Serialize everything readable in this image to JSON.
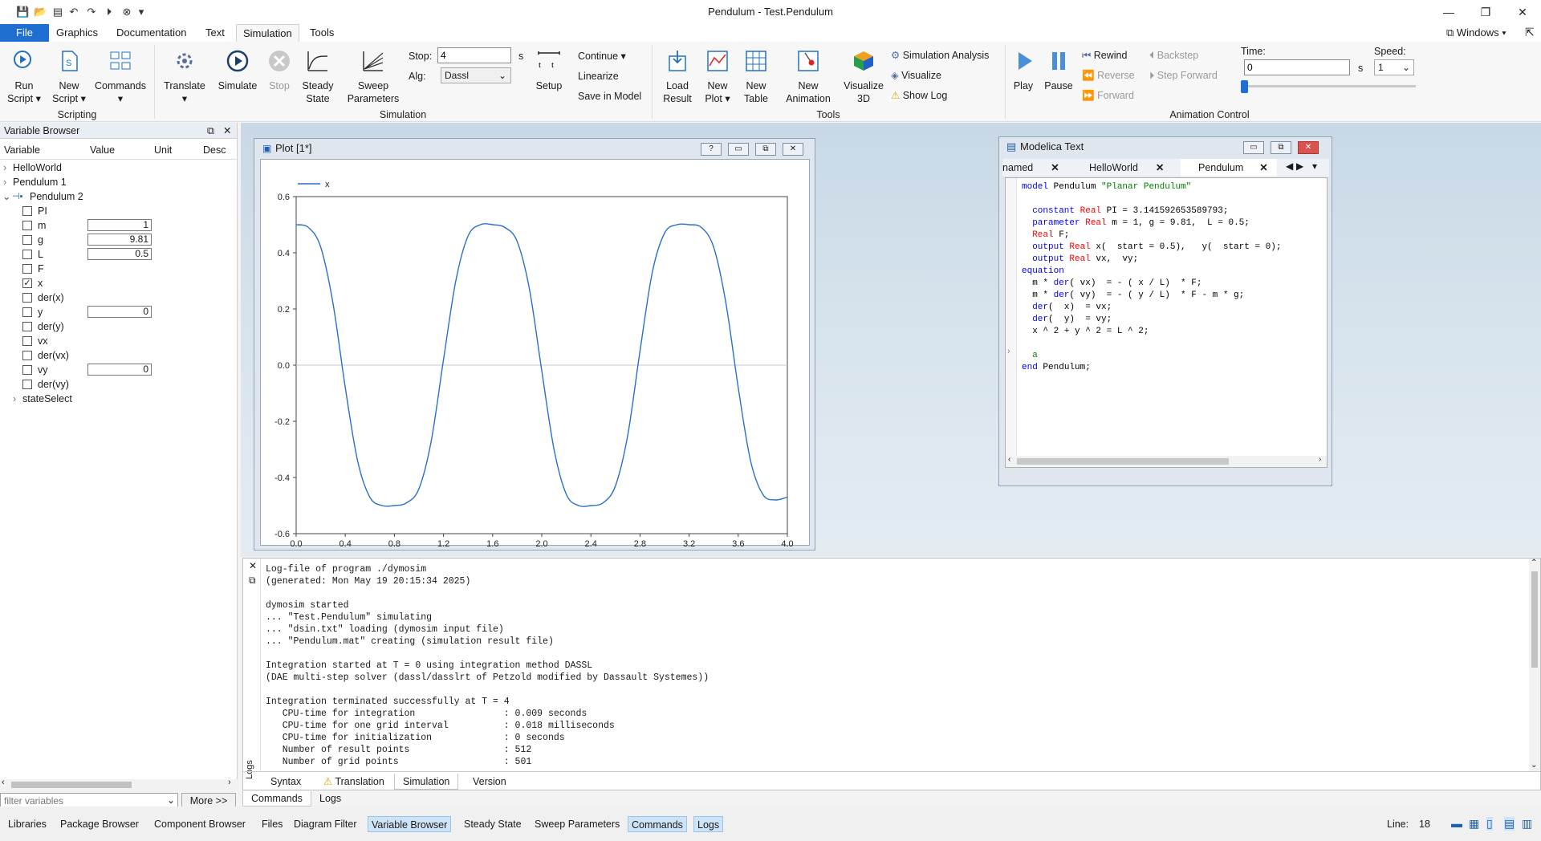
{
  "window": {
    "title": "Pendulum - Test.Pendulum",
    "windows_menu": "Windows"
  },
  "menu": {
    "file": "File",
    "tabs": [
      "Graphics",
      "Documentation",
      "Text",
      "Simulation",
      "Tools"
    ]
  },
  "ribbon": {
    "scripting": {
      "run_script": [
        "Run",
        "Script"
      ],
      "new_script": [
        "New",
        "Script"
      ],
      "commands": "Commands",
      "group": "Scripting"
    },
    "simulation": {
      "translate": "Translate",
      "simulate": "Simulate",
      "stop_btn": "Stop",
      "steady_state": [
        "Steady",
        "State"
      ],
      "sweep": [
        "Sweep",
        "Parameters"
      ],
      "stop_label": "Stop:",
      "stop_value": "4",
      "stop_unit": "s",
      "alg_label": "Alg:",
      "alg_value": "Dassl",
      "setup": "Setup",
      "continue": "Continue",
      "linearize": "Linearize",
      "save_in_model": "Save in Model",
      "group": "Simulation"
    },
    "tools": {
      "load_result": [
        "Load",
        "Result"
      ],
      "new_plot": [
        "New",
        "Plot"
      ],
      "new_table": [
        "New",
        "Table"
      ],
      "new_animation": [
        "New",
        "Animation"
      ],
      "visualize3d": [
        "Visualize",
        "3D"
      ],
      "simulation_analysis": "Simulation Analysis",
      "visualize": "Visualize",
      "show_log": "Show Log",
      "group": "Tools"
    },
    "animation": {
      "play": "Play",
      "pause": "Pause",
      "rewind": "Rewind",
      "reverse": "Reverse",
      "forward": "Forward",
      "backstep": "Backstep",
      "step_forward": "Step Forward",
      "time_label": "Time:",
      "time_value": "0",
      "time_unit": "s",
      "speed_label": "Speed:",
      "speed_value": "1",
      "group": "Animation Control"
    }
  },
  "variable_browser": {
    "title": "Variable Browser",
    "headers": [
      "Variable",
      "Value",
      "Unit",
      "Desc"
    ],
    "top_items": [
      "HelloWorld",
      "Pendulum 1",
      "Pendulum 2"
    ],
    "rows": [
      {
        "name": "PI",
        "value": "",
        "checked": false
      },
      {
        "name": "m",
        "value": "1",
        "checked": false
      },
      {
        "name": "g",
        "value": "9.81",
        "checked": false
      },
      {
        "name": "L",
        "value": "0.5",
        "checked": false
      },
      {
        "name": "F",
        "value": "",
        "checked": false
      },
      {
        "name": "x",
        "value": "",
        "checked": true
      },
      {
        "name": "der(x)",
        "value": "",
        "checked": false
      },
      {
        "name": "y",
        "value": "0",
        "checked": false
      },
      {
        "name": "der(y)",
        "value": "",
        "checked": false
      },
      {
        "name": "vx",
        "value": "",
        "checked": false
      },
      {
        "name": "der(vx)",
        "value": "",
        "checked": false
      },
      {
        "name": "vy",
        "value": "0",
        "checked": false
      },
      {
        "name": "der(vy)",
        "value": "",
        "checked": false
      }
    ],
    "state_select": "stateSelect",
    "filter_placeholder": "filter variables",
    "more": "More >>"
  },
  "plot_window": {
    "title": "Plot [1*]"
  },
  "chart_data": {
    "type": "line",
    "series": [
      {
        "name": "x",
        "color": "#2a6fc9"
      }
    ],
    "xlim": [
      0,
      4.0
    ],
    "ylim": [
      -0.6,
      0.6
    ],
    "xticks": [
      "0.0",
      "0.4",
      "0.8",
      "1.2",
      "1.6",
      "2.0",
      "2.4",
      "2.8",
      "3.2",
      "3.6",
      "4.0"
    ],
    "yticks": [
      "0.6",
      "0.4",
      "0.2",
      "0.0",
      "-0.2",
      "-0.4",
      "-0.6"
    ],
    "points_x": [
      0,
      0.1,
      0.2,
      0.3,
      0.4,
      0.5,
      0.6,
      0.7,
      0.8,
      0.9,
      1.0,
      1.1,
      1.2,
      1.3,
      1.4,
      1.5,
      1.6,
      1.7,
      1.8,
      1.9,
      2.0,
      2.1,
      2.2,
      2.3,
      2.4,
      2.5,
      2.6,
      2.7,
      2.8,
      2.9,
      3.0,
      3.1,
      3.2,
      3.3,
      3.4,
      3.5,
      3.6,
      3.7,
      3.8,
      3.9,
      4.0
    ],
    "points_y": [
      0.5,
      0.49,
      0.42,
      0.22,
      -0.08,
      -0.34,
      -0.47,
      -0.5,
      -0.5,
      -0.49,
      -0.44,
      -0.27,
      0.02,
      0.3,
      0.46,
      0.5,
      0.5,
      0.49,
      0.44,
      0.27,
      -0.02,
      -0.3,
      -0.46,
      -0.5,
      -0.5,
      -0.49,
      -0.43,
      -0.25,
      0.05,
      0.33,
      0.47,
      0.5,
      0.5,
      0.49,
      0.42,
      0.22,
      -0.08,
      -0.34,
      -0.46,
      -0.48,
      -0.47
    ]
  },
  "modelica_window": {
    "title": "Modelica Text",
    "tabs": [
      "named",
      "HelloWorld",
      "Pendulum"
    ],
    "code": [
      [
        [
          "kw",
          "model"
        ],
        [
          "t",
          " Pendulum "
        ],
        [
          "str",
          "\"Planar Pendulum\""
        ]
      ],
      [],
      [
        [
          "t",
          "  "
        ],
        [
          "kw",
          "constant"
        ],
        [
          "t",
          " "
        ],
        [
          "ty",
          "Real"
        ],
        [
          "t",
          " PI = 3.141592653589793;"
        ]
      ],
      [
        [
          "t",
          "  "
        ],
        [
          "kw",
          "parameter"
        ],
        [
          "t",
          " "
        ],
        [
          "ty",
          "Real"
        ],
        [
          "t",
          " m = 1, g = 9.81,  L = 0.5;"
        ]
      ],
      [
        [
          "t",
          "  "
        ],
        [
          "ty",
          "Real"
        ],
        [
          "t",
          " F;"
        ]
      ],
      [
        [
          "t",
          "  "
        ],
        [
          "kw",
          "output"
        ],
        [
          "t",
          " "
        ],
        [
          "ty",
          "Real"
        ],
        [
          "t",
          " x(  start = 0.5),   y(  start = 0);"
        ]
      ],
      [
        [
          "t",
          "  "
        ],
        [
          "kw",
          "output"
        ],
        [
          "t",
          " "
        ],
        [
          "ty",
          "Real"
        ],
        [
          "t",
          " vx,  vy;"
        ]
      ],
      [
        [
          "kw",
          "equation"
        ]
      ],
      [
        [
          "t",
          "  m * "
        ],
        [
          "kw",
          "der"
        ],
        [
          "t",
          "( vx)  = - ( x / L)  * F;"
        ]
      ],
      [
        [
          "t",
          "  m * "
        ],
        [
          "kw",
          "der"
        ],
        [
          "t",
          "( vy)  = - ( y / L)  * F - m * g;"
        ]
      ],
      [
        [
          "t",
          "  "
        ],
        [
          "kw",
          "der"
        ],
        [
          "t",
          "(  x)  = vx;"
        ]
      ],
      [
        [
          "t",
          "  "
        ],
        [
          "kw",
          "der"
        ],
        [
          "t",
          "(  y)  = vy;"
        ]
      ],
      [
        [
          "t",
          "  x ^ 2 + y ^ 2 = L ^ 2;"
        ]
      ],
      [],
      [
        [
          "t",
          "  "
        ],
        [
          "ann",
          "a"
        ]
      ],
      [
        [
          "kw",
          "end"
        ],
        [
          "t",
          " Pendulum;"
        ]
      ]
    ]
  },
  "log": {
    "text": "Log-file of program ./dymosim\n(generated: Mon May 19 20:15:34 2025)\n\ndymosim started\n... \"Test.Pendulum\" simulating\n... \"dsin.txt\" loading (dymosim input file)\n... \"Pendulum.mat\" creating (simulation result file)\n\nIntegration started at T = 0 using integration method DASSL\n(DAE multi-step solver (dassl/dasslrt of Petzold modified by Dassault Systemes))\n\nIntegration terminated successfully at T = 4\n   CPU-time for integration                : 0.009 seconds\n   CPU-time for one grid interval          : 0.018 milliseconds\n   CPU-time for initialization             : 0 seconds\n   Number of result points                 : 512\n   Number of grid points                   : 501",
    "tabs": [
      "Syntax",
      "Translation",
      "Simulation",
      "Version"
    ],
    "side_label": "Logs",
    "bottom_tabs": [
      "Commands",
      "Logs"
    ]
  },
  "statusbar": {
    "items": [
      "Libraries",
      "Package Browser",
      "Component Browser",
      "Files",
      "Diagram Filter",
      "Variable Browser",
      "Steady State",
      "Sweep Parameters",
      "Commands",
      "Logs"
    ],
    "line_label": "Line:",
    "line_value": "18"
  },
  "colors": {
    "accent": "#1e6fd0",
    "plot_line": "#2a6fc9",
    "keyword": "#0000ff",
    "type": "#ff0000",
    "string": "#008000"
  }
}
